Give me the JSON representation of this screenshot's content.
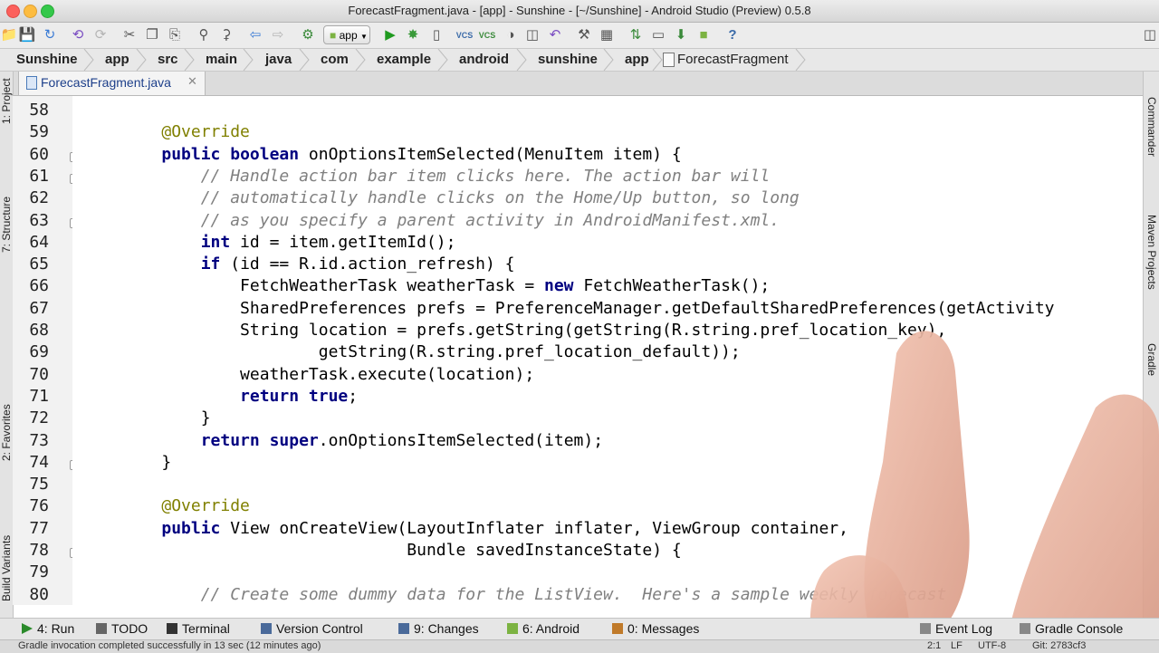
{
  "window": {
    "title": "ForecastFragment.java - [app] - Sunshine - [~/Sunshine] - Android Studio (Preview) 0.5.8"
  },
  "toolbar": {
    "run_config": "app",
    "icons": [
      "open-icon",
      "save-icon",
      "sync-icon",
      "undo-icon",
      "redo-icon",
      "cut-icon",
      "copy-icon",
      "paste-icon",
      "find-icon",
      "replace-icon",
      "back-icon",
      "forward-icon",
      "make-icon",
      "run-icon",
      "debug-icon",
      "attach-icon",
      "vcs-update-icon",
      "vcs-commit-icon",
      "vcs-icon",
      "sdk-manager-icon",
      "avd-icon",
      "help-icon"
    ]
  },
  "breadcrumb": [
    "Sunshine",
    "app",
    "src",
    "main",
    "java",
    "com",
    "example",
    "android",
    "sunshine",
    "app",
    "ForecastFragment"
  ],
  "tabs": [
    {
      "label": "ForecastFragment.java",
      "active": true
    }
  ],
  "left_tools": [
    "1: Project",
    "7: Structure",
    "2: Favorites",
    "Build Variants"
  ],
  "right_tools": [
    "Commander",
    "Maven Projects",
    "Gradle"
  ],
  "editor": {
    "lines": [
      {
        "n": "58",
        "t": ""
      },
      {
        "n": "59",
        "t": "    @Override"
      },
      {
        "n": "60",
        "t": "    public boolean onOptionsItemSelected(MenuItem item) {"
      },
      {
        "n": "61",
        "t": "        // Handle action bar item clicks here. The action bar will"
      },
      {
        "n": "62",
        "t": "        // automatically handle clicks on the Home/Up button, so long"
      },
      {
        "n": "63",
        "t": "        // as you specify a parent activity in AndroidManifest.xml."
      },
      {
        "n": "64",
        "t": "        int id = item.getItemId();"
      },
      {
        "n": "65",
        "t": "        if (id == R.id.action_refresh) {"
      },
      {
        "n": "66",
        "t": "            FetchWeatherTask weatherTask = new FetchWeatherTask();"
      },
      {
        "n": "67",
        "t": "            SharedPreferences prefs = PreferenceManager.getDefaultSharedPreferences(getActivity"
      },
      {
        "n": "68",
        "t": "            String location = prefs.getString(getString(R.string.pref_location_key),"
      },
      {
        "n": "69",
        "t": "                    getString(R.string.pref_location_default));"
      },
      {
        "n": "70",
        "t": "            weatherTask.execute(location);"
      },
      {
        "n": "71",
        "t": "            return true;"
      },
      {
        "n": "72",
        "t": "        }"
      },
      {
        "n": "73",
        "t": "        return super.onOptionsItemSelected(item);"
      },
      {
        "n": "74",
        "t": "    }"
      },
      {
        "n": "75",
        "t": ""
      },
      {
        "n": "76",
        "t": "    @Override"
      },
      {
        "n": "77",
        "t": "    public View onCreateView(LayoutInflater inflater, ViewGroup container,"
      },
      {
        "n": "78",
        "t": "                             Bundle savedInstanceState) {"
      },
      {
        "n": "79",
        "t": ""
      },
      {
        "n": "80",
        "t": "        // Create some dummy data for the ListView.  Here's a sample weekly forecast"
      }
    ]
  },
  "bottom_tools": [
    {
      "label": "4: Run",
      "name": "run-tool",
      "color": "#2a8a2a"
    },
    {
      "label": "TODO",
      "name": "todo-tool",
      "color": "#555555"
    },
    {
      "label": "Terminal",
      "name": "terminal-tool",
      "color": "#333333"
    },
    {
      "label": "Version Control",
      "name": "version-control-tool",
      "color": "#4a6a9a"
    },
    {
      "label": "9: Changes",
      "name": "changes-tool",
      "color": "#4a6a9a"
    },
    {
      "label": "6: Android",
      "name": "android-tool",
      "color": "#7cb342"
    },
    {
      "label": "0: Messages",
      "name": "messages-tool",
      "color": "#c07a2a"
    },
    {
      "label": "Event Log",
      "name": "event-log-tool",
      "color": "#888888"
    },
    {
      "label": "Gradle Console",
      "name": "gradle-console-tool",
      "color": "#888888"
    }
  ],
  "status": {
    "message": "Gradle invocation completed successfully in 13 sec (12 minutes ago)",
    "position": "2:1",
    "line_sep": "LF",
    "encoding": "UTF-8",
    "vcs": "Git: 2783cf3"
  },
  "colors": {
    "keyword": "#000080",
    "comment": "#808080",
    "annotation": "#808000"
  }
}
